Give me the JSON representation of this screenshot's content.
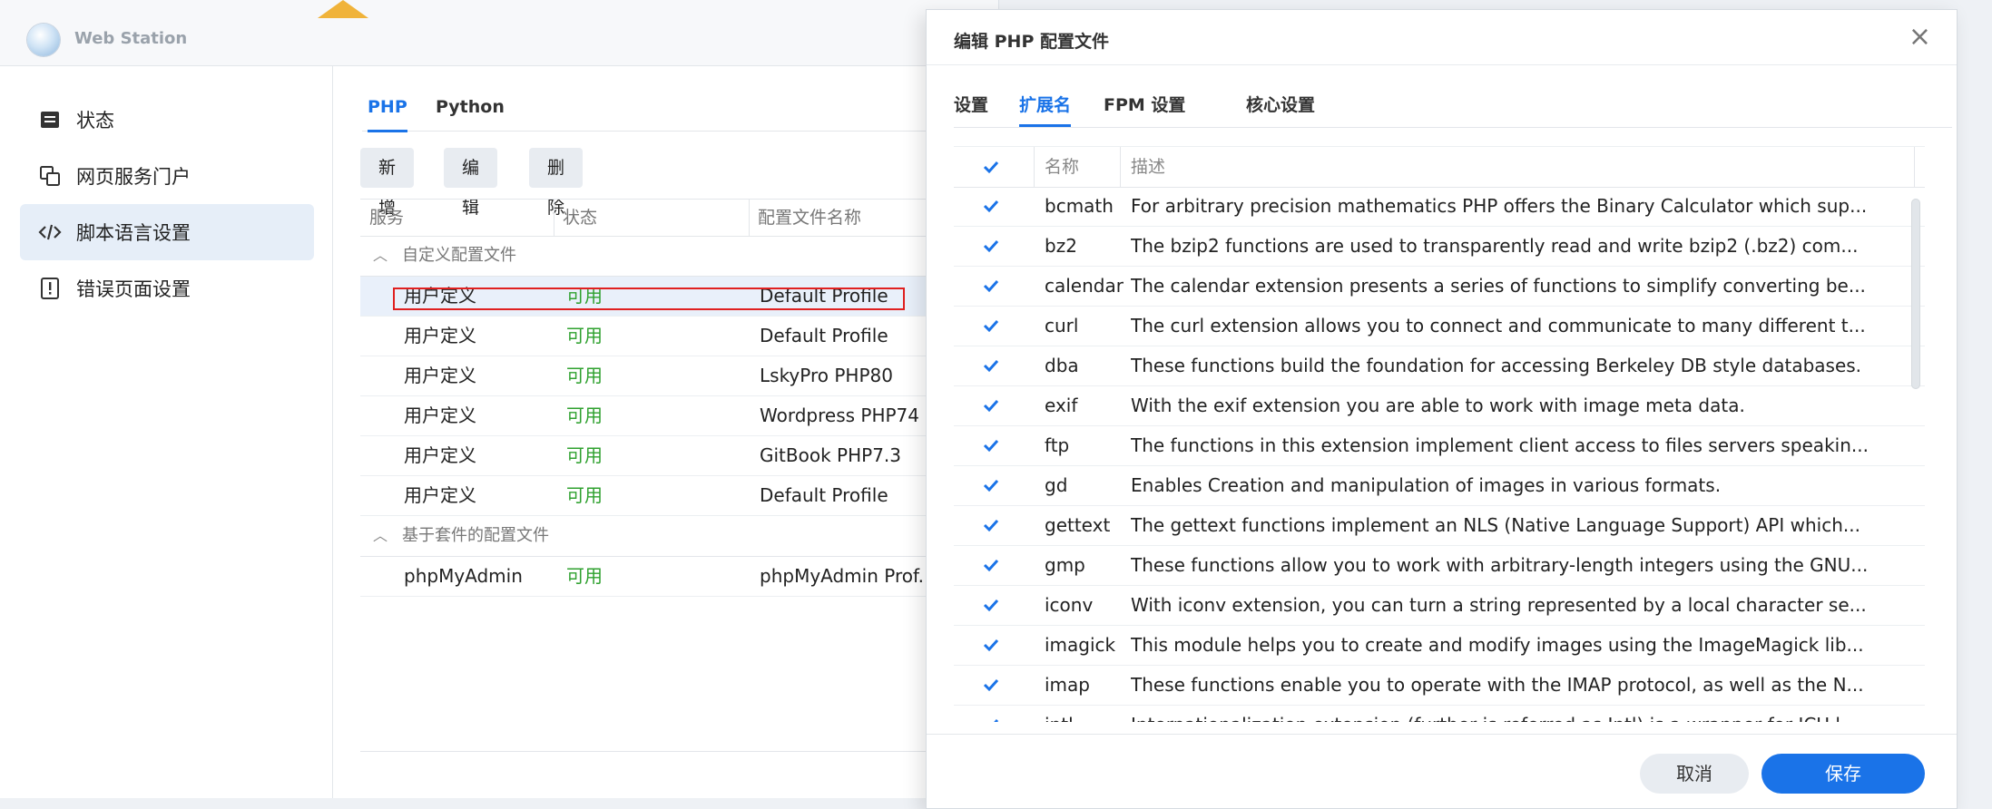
{
  "app": {
    "title": "Web Station"
  },
  "sidebar": {
    "items": [
      {
        "label": "状态",
        "icon": "status-icon"
      },
      {
        "label": "网页服务门户",
        "icon": "portal-icon"
      },
      {
        "label": "脚本语言设置",
        "icon": "code-icon",
        "active": true
      },
      {
        "label": "错误页面设置",
        "icon": "error-page-icon"
      }
    ]
  },
  "main": {
    "tabs": [
      {
        "label": "PHP",
        "active": true
      },
      {
        "label": "Python"
      }
    ],
    "buttons": {
      "add": "新增",
      "edit": "编辑",
      "delete": "删除"
    },
    "columns": {
      "service": "服务",
      "status": "状态",
      "profile": "配置文件名称"
    },
    "groups": [
      {
        "label": "自定义配置文件",
        "rows": [
          {
            "service": "用户定义",
            "status": "可用",
            "profile": "Default Profile",
            "selected": true
          },
          {
            "service": "用户定义",
            "status": "可用",
            "profile": "Default Profile"
          },
          {
            "service": "用户定义",
            "status": "可用",
            "profile": "LskyPro PHP80"
          },
          {
            "service": "用户定义",
            "status": "可用",
            "profile": "Wordpress PHP74"
          },
          {
            "service": "用户定义",
            "status": "可用",
            "profile": "GitBook PHP7.3"
          },
          {
            "service": "用户定义",
            "status": "可用",
            "profile": "Default Profile"
          }
        ]
      },
      {
        "label": "基于套件的配置文件",
        "rows": [
          {
            "service": "phpMyAdmin",
            "status": "可用",
            "profile": "phpMyAdmin Prof..."
          }
        ]
      }
    ]
  },
  "dialog": {
    "title": "编辑 PHP 配置文件",
    "close": "×",
    "tabs": [
      {
        "label": "设置"
      },
      {
        "label": "扩展名",
        "active": true
      },
      {
        "label": "FPM 设置"
      },
      {
        "label": "核心设置"
      }
    ],
    "columns": {
      "name": "名称",
      "description": "描述"
    },
    "extensions": [
      {
        "name": "bcmath",
        "description": "For arbitrary precision mathematics PHP offers the Binary Calculator which sup...",
        "checked": true
      },
      {
        "name": "bz2",
        "description": "The bzip2 functions are used to transparently read and write bzip2 (.bz2) com...",
        "checked": true
      },
      {
        "name": "calendar",
        "description": "The calendar extension presents a series of functions to simplify converting be...",
        "checked": true
      },
      {
        "name": "curl",
        "description": "The curl extension allows you to connect and communicate to many different t...",
        "checked": true
      },
      {
        "name": "dba",
        "description": "These functions build the foundation for accessing Berkeley DB style databases.",
        "checked": true
      },
      {
        "name": "exif",
        "description": "With the exif extension you are able to work with image meta data.",
        "checked": true
      },
      {
        "name": "ftp",
        "description": "The functions in this extension implement client access to files servers speakin...",
        "checked": true
      },
      {
        "name": "gd",
        "description": "Enables Creation and manipulation of images in various formats.",
        "checked": true
      },
      {
        "name": "gettext",
        "description": "The gettext functions implement an NLS (Native Language Support) API which...",
        "checked": true
      },
      {
        "name": "gmp",
        "description": "These functions allow you to work with arbitrary-length integers using the GNU...",
        "checked": true
      },
      {
        "name": "iconv",
        "description": "With iconv extension, you can turn a string represented by a local character se...",
        "checked": true
      },
      {
        "name": "imagick",
        "description": "This module helps you to create and modify images using the ImageMagick lib...",
        "checked": true
      },
      {
        "name": "imap",
        "description": "These functions enable you to operate with the IMAP protocol, as well as the N...",
        "checked": true
      },
      {
        "name": "intl",
        "description": "Internationalization extension (further is referred as Intl) is a wrapper for ICU l...",
        "checked": true
      }
    ],
    "buttons": {
      "cancel": "取消",
      "save": "保存"
    }
  },
  "colors": {
    "accent": "#1a73e8",
    "status_ok": "#2fa12f",
    "highlight_box": "#e02020"
  }
}
